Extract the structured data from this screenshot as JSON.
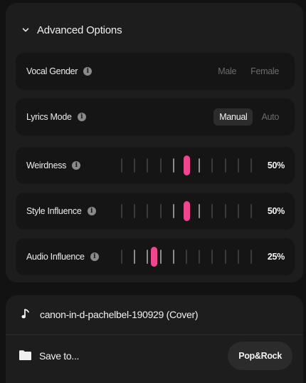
{
  "advanced": {
    "title": "Advanced Options",
    "chevron_icon": "chevron-down-icon",
    "info_glyph": "i"
  },
  "vocal_gender": {
    "label": "Vocal Gender",
    "options": [
      "Male",
      "Female"
    ],
    "selected": null
  },
  "lyrics_mode": {
    "label": "Lyrics Mode",
    "options": [
      "Manual",
      "Auto"
    ],
    "selected": "Manual"
  },
  "sliders": [
    {
      "id": "weirdness",
      "label": "Weirdness",
      "value_text": "50%",
      "value": 0.5
    },
    {
      "id": "style-influence",
      "label": "Style Influence",
      "value_text": "50%",
      "value": 0.5
    },
    {
      "id": "audio-influence",
      "label": "Audio Influence",
      "value_text": "25%",
      "value": 0.25
    }
  ],
  "track": {
    "title": "canon-in-d-pachelbel-190929 (Cover)",
    "icon": "music-note-icon"
  },
  "save": {
    "label": "Save to...",
    "icon": "folder-icon"
  },
  "genre_button": "Pop&Rock",
  "colors": {
    "accent": "#f0468f",
    "background": "#121212",
    "panel": "#1d1d1d",
    "row": "#151515"
  }
}
